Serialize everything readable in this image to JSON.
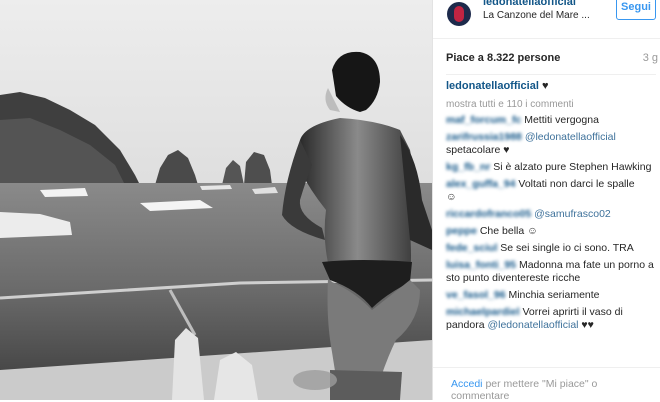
{
  "post": {
    "username": "ledonatellaofficial",
    "location": "La Canzone del Mare ...",
    "follow_label": "Segui",
    "likes": "Piace a 8.322 persone",
    "time": "3 g",
    "caption_user": "ledonatellaofficial",
    "caption_text": "♥",
    "more_comments": "mostra tutti e 110 i commenti"
  },
  "comments": [
    {
      "user": "maf_forcum_fc",
      "text": "Mettiti vergogna"
    },
    {
      "user": "zarifrussia1988",
      "text": "@ledonatellaofficial",
      "text2": "spetacolare ♥"
    },
    {
      "user": "kg_fb_nr",
      "text": "Si è alzato pure Stephen Hawking"
    },
    {
      "user": "alex_guffa_94",
      "text": "Voltati non darci le spalle",
      "emoji": "☺"
    },
    {
      "user": "riccardofranco05",
      "text": "@samufrasco02"
    },
    {
      "user": "peppe",
      "text": "Che bella ☺"
    },
    {
      "user": "fede_sciul",
      "text": "Se sei single io ci sono. TRA"
    },
    {
      "user": "luisa_fonti_95",
      "text": "Madonna ma fate un porno a sto punto diventereste ricche"
    },
    {
      "user": "ve_fasol_96",
      "text": "Minchia seriamente"
    },
    {
      "user": "michaelpardiel",
      "text": "Vorrei aprirti il vaso di pandora",
      "mention": "@ledonatellaofficial",
      "tail": "♥♥"
    }
  ],
  "footer": {
    "login": "Accedi",
    "rest": "per mettere \"Mi piace\" o commentare"
  },
  "colors": {
    "link": "#125688",
    "follow": "#3897f0",
    "muted": "#999999"
  }
}
